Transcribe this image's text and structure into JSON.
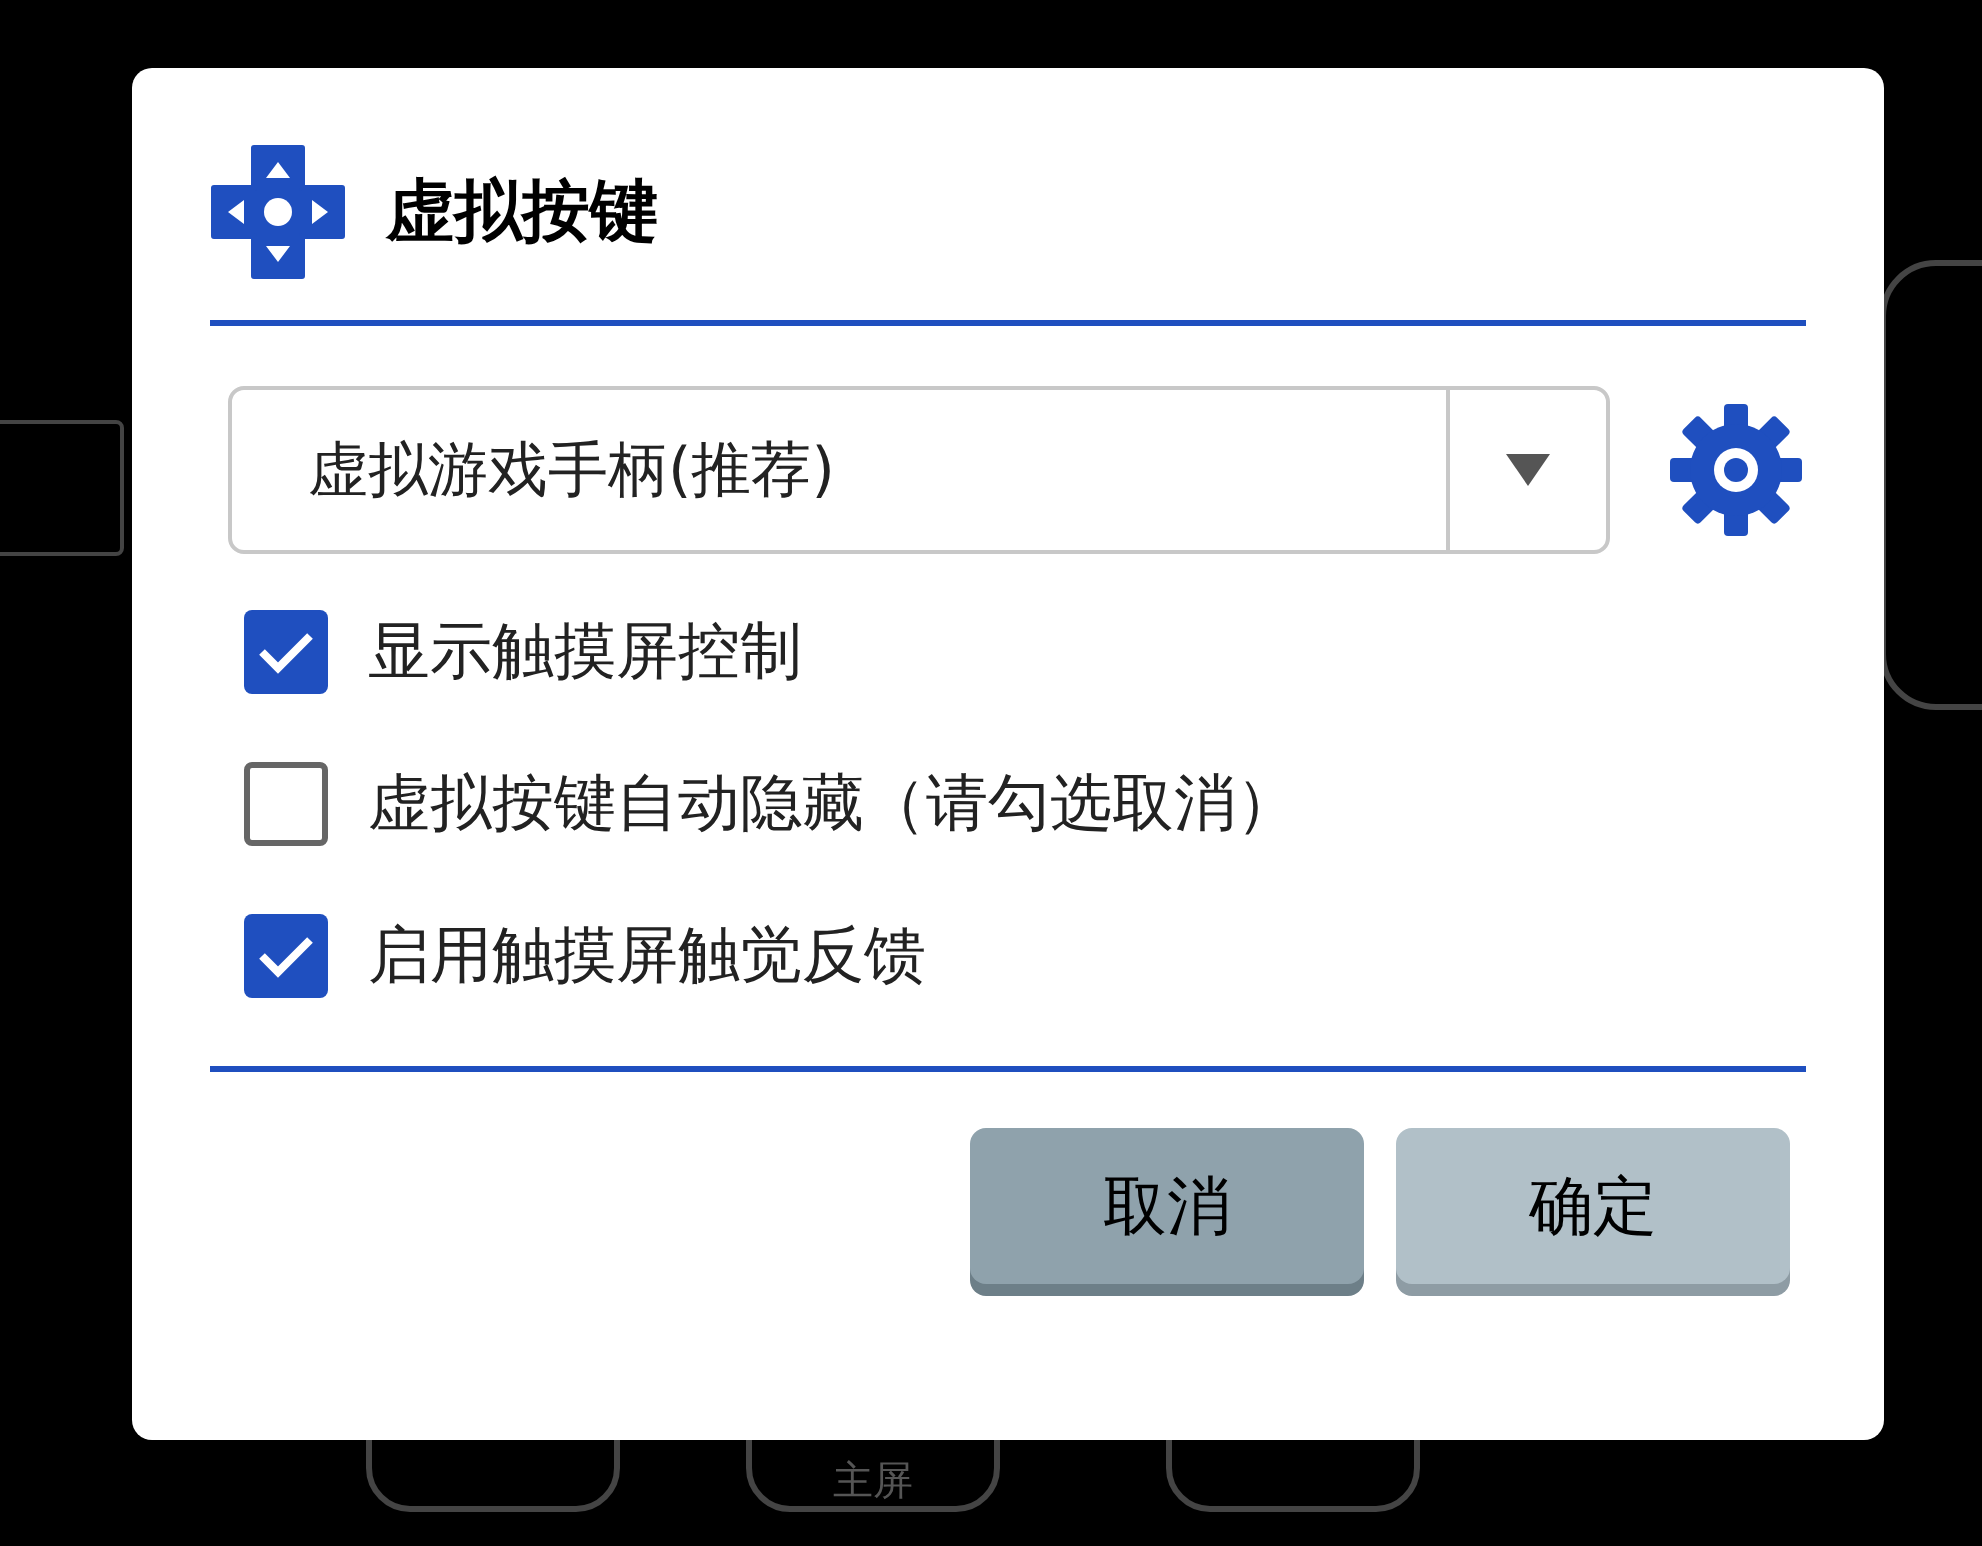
{
  "background": {
    "home_button": "主屏"
  },
  "dialog": {
    "title": "虚拟按键",
    "dropdown": {
      "value": "虚拟游戏手柄(推荐)"
    },
    "options": [
      {
        "label": "显示触摸屏控制",
        "checked": true
      },
      {
        "label": "虚拟按键自动隐藏（请勾选取消）",
        "checked": false
      },
      {
        "label": "启用触摸屏触觉反馈",
        "checked": true
      }
    ],
    "buttons": [
      {
        "label": "取消",
        "kind": "cancel"
      },
      {
        "label": "确定",
        "kind": "ok"
      }
    ]
  }
}
